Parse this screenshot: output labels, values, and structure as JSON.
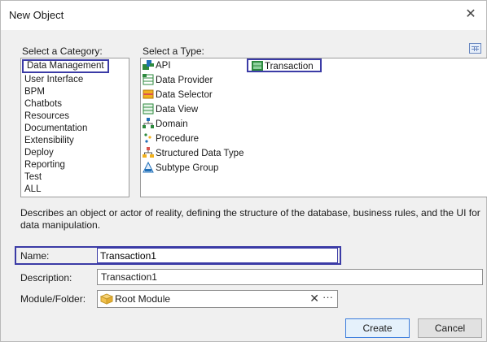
{
  "window": {
    "title": "New Object",
    "close_glyph": "✕"
  },
  "category": {
    "label": "Select a Category:",
    "items": [
      "Data Management",
      "User Interface",
      "BPM",
      "Chatbots",
      "Resources",
      "Documentation",
      "Extensibility",
      "Deploy",
      "Reporting",
      "Test",
      "ALL"
    ],
    "selected": "Data Management"
  },
  "type": {
    "label": "Select a Type:",
    "items": [
      {
        "label": "API",
        "icon": "api-icon"
      },
      {
        "label": "Data Provider",
        "icon": "data-provider-icon"
      },
      {
        "label": "Data Selector",
        "icon": "data-selector-icon"
      },
      {
        "label": "Data View",
        "icon": "data-view-icon"
      },
      {
        "label": "Domain",
        "icon": "domain-icon"
      },
      {
        "label": "Procedure",
        "icon": "procedure-icon"
      },
      {
        "label": "Structured Data Type",
        "icon": "structured-data-type-icon"
      },
      {
        "label": "Subtype Group",
        "icon": "subtype-group-icon"
      },
      {
        "label": "Transaction",
        "icon": "transaction-icon"
      }
    ],
    "selected": "Transaction"
  },
  "description": "Describes an object or actor of reality, defining the structure of the database, business rules, and the UI for data manipulation.",
  "form": {
    "name_label": "Name:",
    "name_value": "Transaction1",
    "description_label": "Description:",
    "description_value": "Transaction1",
    "module_label": "Module/Folder:",
    "module_value": "Root Module",
    "clear_glyph": "✕",
    "more_glyph": "···"
  },
  "buttons": {
    "create": "Create",
    "cancel": "Cancel"
  },
  "colors": {
    "highlight_border": "#3b3ba6",
    "primary_button_border": "#3b7ddd"
  }
}
